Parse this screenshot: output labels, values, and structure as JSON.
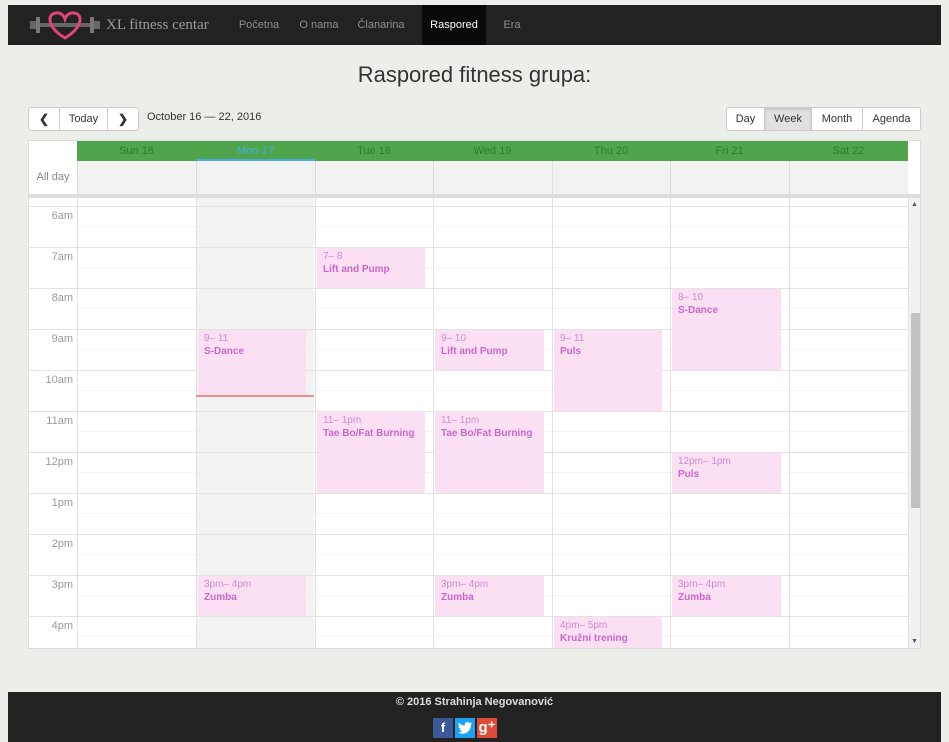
{
  "brand": {
    "name": "XL fitness centar",
    "logo_icon": "heart-dumbbell-icon",
    "accent": "#e0447a"
  },
  "nav": [
    {
      "label": "Početna",
      "active": false
    },
    {
      "label": "O nama",
      "active": false
    },
    {
      "label": "Članarina",
      "active": false
    },
    {
      "label": "Raspored",
      "active": true
    },
    {
      "label": "Era",
      "active": false
    }
  ],
  "page_title": "Raspored fitness grupa:",
  "toolbar": {
    "prev_icon": "chevron-left-icon",
    "today_label": "Today",
    "next_icon": "chevron-right-icon",
    "date_range": "October 16 — 22, 2016",
    "views": [
      "Day",
      "Week",
      "Month",
      "Agenda"
    ],
    "active_view": "Week"
  },
  "calendar": {
    "allday_label": "All day",
    "days": [
      "Sun 16",
      "Mon 17",
      "Tue 18",
      "Wed 19",
      "Thu 20",
      "Fri 21",
      "Sat 22"
    ],
    "today_index": 1,
    "header_color": "#50a44c",
    "event_color": "#fbe0f4",
    "hours": [
      "6am",
      "7am",
      "8am",
      "9am",
      "10am",
      "11am",
      "12pm",
      "1pm",
      "2pm",
      "3pm",
      "4pm"
    ],
    "events": [
      {
        "day": 2,
        "time": "7– 8",
        "name": "Lift and Pump"
      },
      {
        "day": 5,
        "time": "8– 10",
        "name": "S-Dance"
      },
      {
        "day": 1,
        "time": "9– 11",
        "name": "S-Dance"
      },
      {
        "day": 3,
        "time": "9– 10",
        "name": "Lift and Pump"
      },
      {
        "day": 4,
        "time": "9– 11",
        "name": "Puls"
      },
      {
        "day": 2,
        "time": "11– 1pm",
        "name": "Tae Bo/Fat Burning"
      },
      {
        "day": 3,
        "time": "11– 1pm",
        "name": "Tae Bo/Fat Burning"
      },
      {
        "day": 5,
        "time": "12pm– 1pm",
        "name": "Puls"
      },
      {
        "day": 1,
        "time": "3pm– 4pm",
        "name": "Zumba"
      },
      {
        "day": 3,
        "time": "3pm– 4pm",
        "name": "Zumba"
      },
      {
        "day": 5,
        "time": "3pm– 4pm",
        "name": "Zumba"
      },
      {
        "day": 4,
        "time": "4pm– 5pm",
        "name": "Kružni trening"
      }
    ]
  },
  "footer": {
    "copyright": "© 2016 Strahinja Negovanović",
    "social": [
      {
        "icon": "facebook-icon",
        "glyph": "f",
        "color": "#3b5998"
      },
      {
        "icon": "twitter-icon",
        "glyph": "t",
        "color": "#1da1f2"
      },
      {
        "icon": "google-plus-icon",
        "glyph": "g+",
        "color": "#dd4b39"
      }
    ]
  }
}
